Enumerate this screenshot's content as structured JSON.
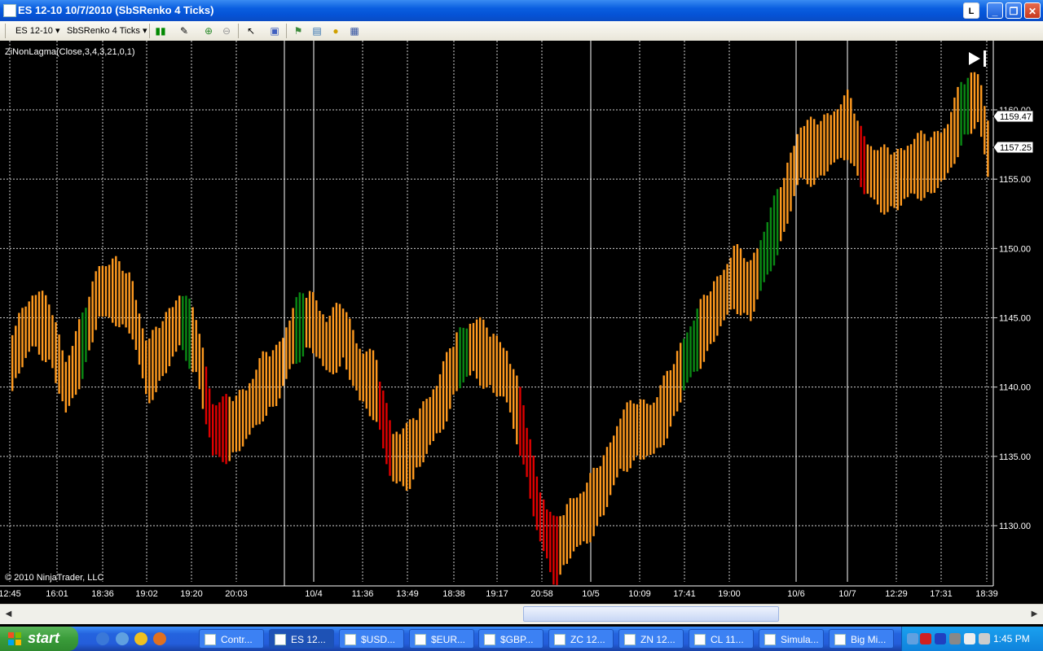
{
  "window": {
    "title": "ES 12-10  10/7/2010 (SbSRenko 4 Ticks)",
    "extra_btn": "L"
  },
  "toolbar": {
    "instrument": "ES 12-10",
    "bar_type": "SbSRenko 4 Ticks"
  },
  "chart": {
    "indicator_label": "ZiNonLagma(Close,3,4,3,21,0,1)",
    "copyright": "© 2010 NinjaTrader, LLC",
    "price_labels": [
      "1160.00",
      "1155.00",
      "1150.00",
      "1145.00",
      "1140.00",
      "1135.00",
      "1130.00"
    ],
    "price_values": [
      1160,
      1155,
      1150,
      1145,
      1140,
      1135,
      1130
    ],
    "time_labels": [
      "12:45",
      "16:01",
      "18:36",
      "19:02",
      "19:20",
      "20:03",
      "10/4",
      "11:36",
      "13:49",
      "18:38",
      "19:17",
      "20:58",
      "10/5",
      "10:09",
      "17:41",
      "19:00",
      "10/6",
      "10/7",
      "12:29",
      "17:31",
      "18:39"
    ],
    "last_price_a": "1159.47",
    "last_price_b": "1157.25",
    "colors": {
      "up": "#ff9a1f",
      "down_trend": "#e00000",
      "up_trend": "#0a8a14",
      "grid": "#ffffff",
      "background": "#000000"
    }
  },
  "chart_data": {
    "type": "bar",
    "style": "renko-range-bars",
    "ylim": [
      1126,
      1162
    ],
    "x_tick_labels": [
      "12:45",
      "16:01",
      "18:36",
      "19:02",
      "19:20",
      "20:03",
      "10/4",
      "11:36",
      "13:49",
      "18:38",
      "19:17",
      "20:58",
      "10/5",
      "10:09",
      "17:41",
      "19:00",
      "10/6",
      "10/7",
      "12:29",
      "17:31",
      "18:39"
    ],
    "y_tick_labels": [
      "1130.00",
      "1135.00",
      "1140.00",
      "1145.00",
      "1150.00",
      "1155.00",
      "1160.00"
    ],
    "series": [
      {
        "values_path": [
          [
            0,
            1139
          ],
          [
            20,
            1143
          ],
          [
            40,
            1145
          ],
          [
            60,
            1144
          ],
          [
            80,
            1140
          ],
          [
            100,
            1143
          ],
          [
            120,
            1147
          ],
          [
            140,
            1147
          ],
          [
            160,
            1146
          ],
          [
            180,
            1141
          ],
          [
            200,
            1143
          ],
          [
            220,
            1145
          ],
          [
            240,
            1143
          ],
          [
            260,
            1137
          ],
          [
            280,
            1137
          ],
          [
            300,
            1138
          ],
          [
            320,
            1140
          ],
          [
            340,
            1141
          ],
          [
            360,
            1144
          ],
          [
            380,
            1145
          ],
          [
            400,
            1143
          ],
          [
            420,
            1144
          ],
          [
            440,
            1141
          ],
          [
            460,
            1140
          ],
          [
            480,
            1135
          ],
          [
            500,
            1135
          ],
          [
            520,
            1137
          ],
          [
            540,
            1139
          ],
          [
            560,
            1142
          ],
          [
            580,
            1143
          ],
          [
            600,
            1142
          ],
          [
            620,
            1141
          ],
          [
            640,
            1137
          ],
          [
            660,
            1131
          ],
          [
            680,
            1128
          ],
          [
            700,
            1130
          ],
          [
            720,
            1131
          ],
          [
            740,
            1133
          ],
          [
            760,
            1136
          ],
          [
            780,
            1137
          ],
          [
            800,
            1137
          ],
          [
            820,
            1139
          ],
          [
            840,
            1142
          ],
          [
            860,
            1144
          ],
          [
            880,
            1146
          ],
          [
            900,
            1148
          ],
          [
            920,
            1147
          ],
          [
            940,
            1150
          ],
          [
            960,
            1153
          ],
          [
            980,
            1157
          ],
          [
            1000,
            1157
          ],
          [
            1020,
            1158
          ],
          [
            1040,
            1159
          ],
          [
            1060,
            1156
          ],
          [
            1080,
            1155
          ],
          [
            1100,
            1155
          ],
          [
            1120,
            1156
          ],
          [
            1140,
            1156
          ],
          [
            1160,
            1157
          ],
          [
            1180,
            1160
          ],
          [
            1200,
            1161
          ],
          [
            1212,
            1157
          ]
        ]
      }
    ],
    "last_values": [
      1159.47,
      1157.25
    ]
  },
  "scrollbar": {
    "left_arrow": "◀",
    "right_arrow": "▶"
  },
  "taskbar": {
    "start_label": "start",
    "tasks": [
      "Contr...",
      "ES 12...",
      "$USD...",
      "$EUR...",
      "$GBP...",
      "ZC 12...",
      "ZN 12...",
      "CL 11...",
      "Simula...",
      "Big Mi..."
    ],
    "clock": "1:45 PM"
  }
}
